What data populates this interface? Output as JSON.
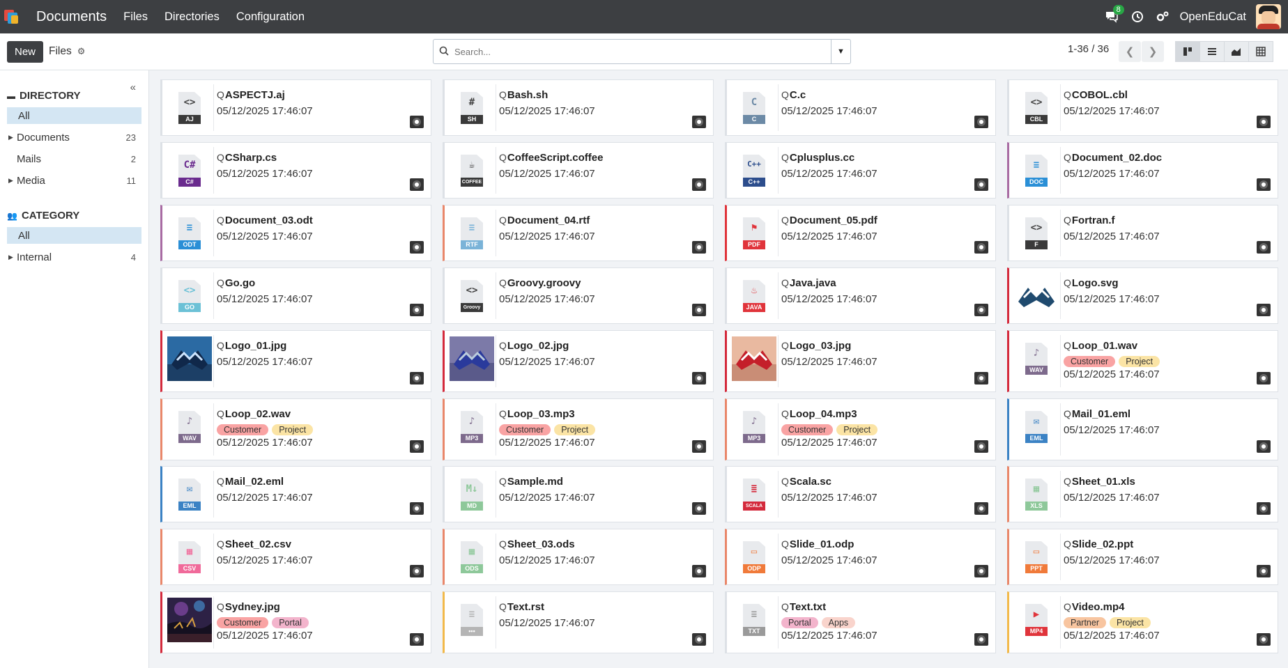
{
  "nav": {
    "app_name": "Documents",
    "menu": [
      "Files",
      "Directories",
      "Configuration"
    ],
    "chat_badge": "8",
    "company": "OpenEduCat"
  },
  "control": {
    "new_label": "New",
    "breadcrumb": "Files",
    "search_placeholder": "Search...",
    "pager": "1-36 / 36"
  },
  "sidebar": {
    "directory_title": "DIRECTORY",
    "directory_items": [
      {
        "label": "All",
        "count": ""
      },
      {
        "label": "Documents",
        "count": "23"
      },
      {
        "label": "Mails",
        "count": "2"
      },
      {
        "label": "Media",
        "count": "11"
      }
    ],
    "category_title": "CATEGORY",
    "category_items": [
      {
        "label": "All",
        "count": ""
      },
      {
        "label": "Internal",
        "count": "4"
      }
    ]
  },
  "tag_colors": {
    "Customer": "#f9a3a3",
    "Project": "#fbe4a5",
    "Portal": "#f3b4cc",
    "Apps": "#f9d4cc",
    "Partner": "#f8c5a0"
  },
  "files": [
    {
      "name": "ASPECTJ.aj",
      "date": "05/12/2025 17:46:07",
      "ext": "AJ",
      "glyph": "<>",
      "ext_color": "#3a3a3a",
      "border": "#dde1e6",
      "tags": []
    },
    {
      "name": "Bash.sh",
      "date": "05/12/2025 17:46:07",
      "ext": "SH",
      "glyph": "#",
      "ext_color": "#3a3a3a",
      "border": "#dde1e6",
      "tags": []
    },
    {
      "name": "C.c",
      "date": "05/12/2025 17:46:07",
      "ext": "C",
      "glyph": "C",
      "ext_color": "#6c8aa6",
      "border": "#dde1e6",
      "tags": []
    },
    {
      "name": "COBOL.cbl",
      "date": "05/12/2025 17:46:07",
      "ext": "CBL",
      "glyph": "<>",
      "ext_color": "#3a3a3a",
      "border": "#dde1e6",
      "tags": []
    },
    {
      "name": "CSharp.cs",
      "date": "05/12/2025 17:46:07",
      "ext": "C#",
      "glyph": "C#",
      "ext_color": "#6a2b8e",
      "border": "#dde1e6",
      "tags": []
    },
    {
      "name": "CoffeeScript.coffee",
      "date": "05/12/2025 17:46:07",
      "ext": "COFFEE",
      "glyph": "☕",
      "ext_color": "#3a3a3a",
      "border": "#dde1e6",
      "tags": []
    },
    {
      "name": "Cplusplus.cc",
      "date": "05/12/2025 17:46:07",
      "ext": "C++",
      "glyph": "C++",
      "ext_color": "#2c4d8c",
      "border": "#dde1e6",
      "tags": []
    },
    {
      "name": "Document_02.doc",
      "date": "05/12/2025 17:46:07",
      "ext": "DOC",
      "glyph": "≡",
      "ext_color": "#2a8fd6",
      "border": "#a86ba3",
      "tags": []
    },
    {
      "name": "Document_03.odt",
      "date": "05/12/2025 17:46:07",
      "ext": "ODT",
      "glyph": "≡",
      "ext_color": "#2a8fd6",
      "border": "#a86ba3",
      "tags": []
    },
    {
      "name": "Document_04.rtf",
      "date": "05/12/2025 17:46:07",
      "ext": "RTF",
      "glyph": "≡",
      "ext_color": "#7ab3d8",
      "border": "#e9876a",
      "tags": []
    },
    {
      "name": "Document_05.pdf",
      "date": "05/12/2025 17:46:07",
      "ext": "PDF",
      "glyph": "⚑",
      "ext_color": "#e0343b",
      "border": "#e0343b",
      "tags": []
    },
    {
      "name": "Fortran.f",
      "date": "05/12/2025 17:46:07",
      "ext": "F",
      "glyph": "<>",
      "ext_color": "#3a3a3a",
      "border": "#dde1e6",
      "tags": []
    },
    {
      "name": "Go.go",
      "date": "05/12/2025 17:46:07",
      "ext": "GO",
      "glyph": "<>",
      "ext_color": "#6cc1d6",
      "border": "#dde1e6",
      "tags": []
    },
    {
      "name": "Groovy.groovy",
      "date": "05/12/2025 17:46:07",
      "ext": "Groovy",
      "glyph": "<>",
      "ext_color": "#3a3a3a",
      "border": "#dde1e6",
      "tags": []
    },
    {
      "name": "Java.java",
      "date": "05/12/2025 17:46:07",
      "ext": "JAVA",
      "glyph": "♨",
      "ext_color": "#e0343b",
      "border": "#dde1e6",
      "tags": []
    },
    {
      "name": "Logo.svg",
      "date": "05/12/2025 17:46:07",
      "ext": "",
      "glyph": "",
      "ext_color": "",
      "border": "#d42a3c",
      "tags": [],
      "image": "logo-plain"
    },
    {
      "name": "Logo_01.jpg",
      "date": "05/12/2025 17:46:07",
      "ext": "",
      "glyph": "",
      "ext_color": "",
      "border": "#d42a3c",
      "tags": [],
      "image": "logo-blue"
    },
    {
      "name": "Logo_02.jpg",
      "date": "05/12/2025 17:46:07",
      "ext": "",
      "glyph": "",
      "ext_color": "",
      "border": "#d42a3c",
      "tags": [],
      "image": "logo-purple"
    },
    {
      "name": "Logo_03.jpg",
      "date": "05/12/2025 17:46:07",
      "ext": "",
      "glyph": "",
      "ext_color": "",
      "border": "#d42a3c",
      "tags": [],
      "image": "logo-red"
    },
    {
      "name": "Loop_01.wav",
      "date": "05/12/2025 17:46:07",
      "ext": "WAV",
      "glyph": "♪",
      "ext_color": "#7d6a8c",
      "border": "#d42a3c",
      "tags": [
        "Customer",
        "Project"
      ]
    },
    {
      "name": "Loop_02.wav",
      "date": "05/12/2025 17:46:07",
      "ext": "WAV",
      "glyph": "♪",
      "ext_color": "#7d6a8c",
      "border": "#e9876a",
      "tags": [
        "Customer",
        "Project"
      ]
    },
    {
      "name": "Loop_03.mp3",
      "date": "05/12/2025 17:46:07",
      "ext": "MP3",
      "glyph": "♪",
      "ext_color": "#7d6a8c",
      "border": "#e9876a",
      "tags": [
        "Customer",
        "Project"
      ]
    },
    {
      "name": "Loop_04.mp3",
      "date": "05/12/2025 17:46:07",
      "ext": "MP3",
      "glyph": "♪",
      "ext_color": "#7d6a8c",
      "border": "#e9876a",
      "tags": [
        "Customer",
        "Project"
      ]
    },
    {
      "name": "Mail_01.eml",
      "date": "05/12/2025 17:46:07",
      "ext": "EML",
      "glyph": "✉",
      "ext_color": "#3b82c4",
      "border": "#3b82c4",
      "tags": []
    },
    {
      "name": "Mail_02.eml",
      "date": "05/12/2025 17:46:07",
      "ext": "EML",
      "glyph": "✉",
      "ext_color": "#3b82c4",
      "border": "#3b82c4",
      "tags": []
    },
    {
      "name": "Sample.md",
      "date": "05/12/2025 17:46:07",
      "ext": "MD",
      "glyph": "M↓",
      "ext_color": "#8ec89a",
      "border": "#dde1e6",
      "tags": []
    },
    {
      "name": "Scala.sc",
      "date": "05/12/2025 17:46:07",
      "ext": "SCALA",
      "glyph": "≣",
      "ext_color": "#d42a3c",
      "border": "#dde1e6",
      "tags": []
    },
    {
      "name": "Sheet_01.xls",
      "date": "05/12/2025 17:46:07",
      "ext": "XLS",
      "glyph": "▦",
      "ext_color": "#8ec89a",
      "border": "#e9876a",
      "tags": []
    },
    {
      "name": "Sheet_02.csv",
      "date": "05/12/2025 17:46:07",
      "ext": "CSV",
      "glyph": "▦",
      "ext_color": "#f06a9a",
      "border": "#e9876a",
      "tags": []
    },
    {
      "name": "Sheet_03.ods",
      "date": "05/12/2025 17:46:07",
      "ext": "ODS",
      "glyph": "▦",
      "ext_color": "#8ec89a",
      "border": "#e9876a",
      "tags": []
    },
    {
      "name": "Slide_01.odp",
      "date": "05/12/2025 17:46:07",
      "ext": "ODP",
      "glyph": "▭",
      "ext_color": "#f07a3a",
      "border": "#e9876a",
      "tags": []
    },
    {
      "name": "Slide_02.ppt",
      "date": "05/12/2025 17:46:07",
      "ext": "PPT",
      "glyph": "▭",
      "ext_color": "#f07a3a",
      "border": "#e9876a",
      "tags": []
    },
    {
      "name": "Sydney.jpg",
      "date": "05/12/2025 17:46:07",
      "ext": "",
      "glyph": "",
      "ext_color": "",
      "border": "#d42a3c",
      "tags": [
        "Customer",
        "Portal"
      ],
      "image": "sydney"
    },
    {
      "name": "Text.rst",
      "date": "05/12/2025 17:46:07",
      "ext": "•••",
      "glyph": "≡",
      "ext_color": "#b5b5b5",
      "border": "#f2b94a",
      "tags": []
    },
    {
      "name": "Text.txt",
      "date": "05/12/2025 17:46:07",
      "ext": "TXT",
      "glyph": "≡",
      "ext_color": "#9a9a9a",
      "border": "#dde1e6",
      "tags": [
        "Portal",
        "Apps"
      ]
    },
    {
      "name": "Video.mp4",
      "date": "05/12/2025 17:46:07",
      "ext": "MP4",
      "glyph": "▶",
      "ext_color": "#e0343b",
      "border": "#f2b94a",
      "tags": [
        "Partner",
        "Project"
      ]
    }
  ]
}
